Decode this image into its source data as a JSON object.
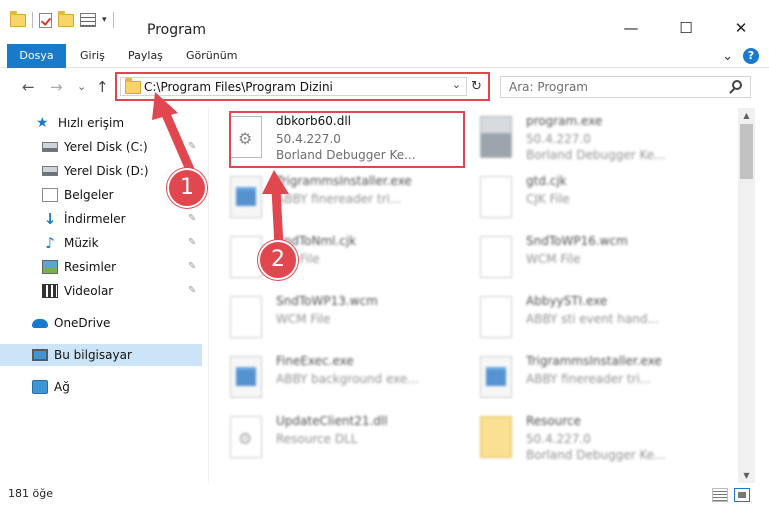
{
  "window": {
    "title": "Program",
    "minimize": "—",
    "maximize": "☐",
    "close": "✕"
  },
  "ribbon": {
    "tabs": [
      "Dosya",
      "Giriş",
      "Paylaş",
      "Görünüm"
    ],
    "expand": "⌄",
    "help": "?"
  },
  "nav": {
    "back": "←",
    "forward": "→",
    "recent": "⌄",
    "up": "↑"
  },
  "address": {
    "path": "C:\\Program Files\\Program Dizini",
    "dropdown": "⌄",
    "refresh": "↻"
  },
  "search": {
    "placeholder": "Ara: Program"
  },
  "sidebar": {
    "items": [
      {
        "label": "Hızlı erişim",
        "icon": "star-icon"
      },
      {
        "label": "Yerel Disk (C:)",
        "icon": "drive-icon",
        "pinned": true
      },
      {
        "label": "Yerel Disk (D:)",
        "icon": "drive-icon"
      },
      {
        "label": "Belgeler",
        "icon": "documents-icon"
      },
      {
        "label": "İndirmeler",
        "icon": "download-icon",
        "pinned": true
      },
      {
        "label": "Müzik",
        "icon": "music-icon",
        "pinned": true
      },
      {
        "label": "Resimler",
        "icon": "pictures-icon",
        "pinned": true
      },
      {
        "label": "Videolar",
        "icon": "videos-icon",
        "pinned": true
      },
      {
        "label": "OneDrive",
        "icon": "onedrive-icon"
      },
      {
        "label": "Bu bilgisayar",
        "icon": "pc-icon",
        "selected": true
      },
      {
        "label": "Ağ",
        "icon": "network-icon"
      }
    ],
    "pin_glyph": "📌"
  },
  "files": [
    {
      "name": "dbkorb60.dll",
      "line2": "50.4.227.0",
      "line3": "Borland Debugger Ke...",
      "icon": "dll-icon",
      "highlighted": true
    },
    {
      "name": "program.exe",
      "line2": "50.4.227.0",
      "line3": "Borland Debugger Ke...",
      "icon": "program-icon"
    },
    {
      "name": "TrigrammsInstaller.exe",
      "line2": "ABBY finereader tri...",
      "line3": "",
      "icon": "exe-icon"
    },
    {
      "name": "gtd.cjk",
      "line2": "CJK File",
      "line3": "",
      "icon": "document-icon"
    },
    {
      "name": "SndToNml.cjk",
      "line2": "CJK File",
      "line3": "",
      "icon": "document-icon"
    },
    {
      "name": "SndToWP16.wcm",
      "line2": "WCM File",
      "line3": "",
      "icon": "document-icon"
    },
    {
      "name": "SndToWP13.wcm",
      "line2": "WCM File",
      "line3": "",
      "icon": "document-icon"
    },
    {
      "name": "AbbyySTI.exe",
      "line2": "ABBY sti event hand...",
      "line3": "",
      "icon": "document-icon"
    },
    {
      "name": "FineExec.exe",
      "line2": "ABBY background exe...",
      "line3": "",
      "icon": "exe-icon"
    },
    {
      "name": "TrigrammsInstaller.exe",
      "line2": "ABBY finereader tri...",
      "line3": "",
      "icon": "exe-icon"
    },
    {
      "name": "UpdateClient21.dll",
      "line2": "Resource DLL",
      "line3": "",
      "icon": "dll-icon"
    },
    {
      "name": "Resource",
      "line2": "50.4.227.0",
      "line3": "Borland Debugger Ke...",
      "icon": "resource-icon"
    }
  ],
  "status": {
    "count": "181 öğe"
  },
  "scrollbar": {
    "up": "▲",
    "down": "▼"
  },
  "callouts": [
    "1",
    "2"
  ],
  "colors": {
    "accent": "#1979ca",
    "highlight": "#e0474f"
  }
}
